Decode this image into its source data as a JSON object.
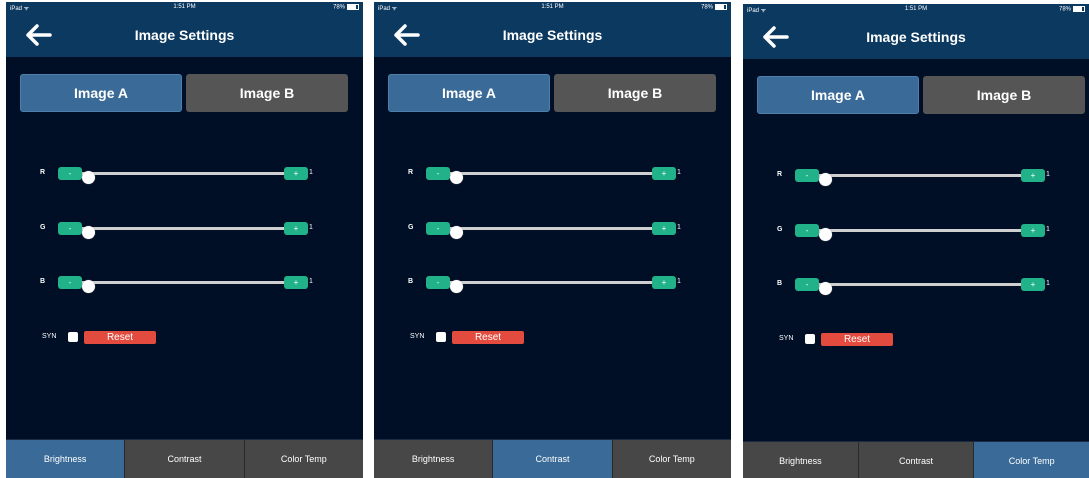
{
  "screens": [
    {
      "status": {
        "left": "iPad ᯤ",
        "time": "1:51 PM",
        "battery": "78%"
      },
      "title": "Image Settings",
      "segments": [
        {
          "label": "Image A",
          "selected": true
        },
        {
          "label": "Image B",
          "selected": false
        }
      ],
      "sliders": [
        {
          "label": "R",
          "minus": "-",
          "plus": "+",
          "value": "1",
          "level": 0.0
        },
        {
          "label": "G",
          "minus": "-",
          "plus": "+",
          "value": "1",
          "level": 0.0
        },
        {
          "label": "B",
          "minus": "-",
          "plus": "+",
          "value": "1",
          "level": 0.0
        }
      ],
      "syn_label": "SYN",
      "syn_checked": false,
      "reset_label": "Reset",
      "tabs": [
        {
          "label": "Brightness",
          "selected": true
        },
        {
          "label": "Contrast",
          "selected": false
        },
        {
          "label": "Color Temp",
          "selected": false
        }
      ]
    },
    {
      "status": {
        "left": "iPad ᯤ",
        "time": "1:51 PM",
        "battery": "78%"
      },
      "title": "Image Settings",
      "segments": [
        {
          "label": "Image A",
          "selected": true
        },
        {
          "label": "Image B",
          "selected": false
        }
      ],
      "sliders": [
        {
          "label": "R",
          "minus": "-",
          "plus": "+",
          "value": "1",
          "level": 0.0
        },
        {
          "label": "G",
          "minus": "-",
          "plus": "+",
          "value": "1",
          "level": 0.0
        },
        {
          "label": "B",
          "minus": "-",
          "plus": "+",
          "value": "1",
          "level": 0.0
        }
      ],
      "syn_label": "SYN",
      "syn_checked": false,
      "reset_label": "Reset",
      "tabs": [
        {
          "label": "Brightness",
          "selected": false
        },
        {
          "label": "Contrast",
          "selected": true
        },
        {
          "label": "Color Temp",
          "selected": false
        }
      ]
    },
    {
      "status": {
        "left": "iPad ᯤ",
        "time": "1:51 PM",
        "battery": "78%"
      },
      "title": "Image Settings",
      "segments": [
        {
          "label": "Image A",
          "selected": true
        },
        {
          "label": "Image B",
          "selected": false
        }
      ],
      "sliders": [
        {
          "label": "R",
          "minus": "-",
          "plus": "+",
          "value": "1",
          "level": 0.0
        },
        {
          "label": "G",
          "minus": "-",
          "plus": "+",
          "value": "1",
          "level": 0.0
        },
        {
          "label": "B",
          "minus": "-",
          "plus": "+",
          "value": "1",
          "level": 0.0
        }
      ],
      "syn_label": "SYN",
      "syn_checked": false,
      "reset_label": "Reset",
      "tabs": [
        {
          "label": "Brightness",
          "selected": false
        },
        {
          "label": "Contrast",
          "selected": false
        },
        {
          "label": "Color Temp",
          "selected": true
        }
      ]
    }
  ],
  "colors": {
    "background": "#000f26",
    "navbar": "#0c3960",
    "accent_green": "#21b28a",
    "reset_red": "#e34b3f",
    "active_blue": "#3a6a98",
    "inactive_gray": "#555555"
  },
  "icons": {
    "back": "back-arrow-icon",
    "battery": "battery-icon"
  }
}
